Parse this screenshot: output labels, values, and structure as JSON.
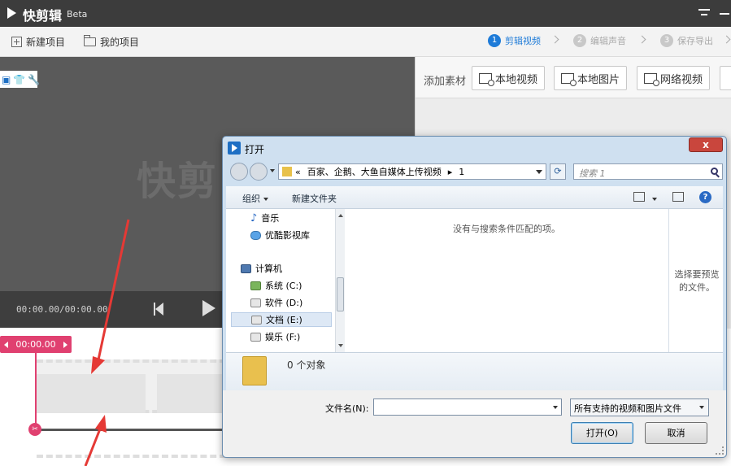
{
  "app": {
    "title": "快剪辑",
    "subtitle": "Beta"
  },
  "toolbar": {
    "new_project": "新建项目",
    "my_projects": "我的项目",
    "steps": [
      {
        "num": "1",
        "label": "剪辑视频",
        "active": true
      },
      {
        "num": "2",
        "label": "编辑声音",
        "active": false
      },
      {
        "num": "3",
        "label": "保存导出",
        "active": false
      }
    ]
  },
  "preview": {
    "watermark": "快剪",
    "timecode": "00:00.00/00:00.00"
  },
  "media": {
    "add_label": "添加素材",
    "local_video": "本地视频",
    "local_image": "本地图片",
    "web_video": "网络视频"
  },
  "timeline": {
    "time": "00:00.00"
  },
  "dialog": {
    "title": "打开",
    "close": "x",
    "breadcrumb": [
      "«",
      "百家、企鹅、大鱼自媒体上传视频",
      "▸",
      "1"
    ],
    "search_placeholder": "搜索 1",
    "organize": "组织",
    "new_folder": "新建文件夹",
    "nav_items": [
      {
        "label": "音乐",
        "icon": "music-icon"
      },
      {
        "label": "优酷影视库",
        "icon": "cloud-icon"
      },
      {
        "label": "计算机",
        "icon": "computer-icon"
      },
      {
        "label": "系统 (C:)",
        "icon": "system-drive-icon"
      },
      {
        "label": "软件 (D:)",
        "icon": "drive-icon"
      },
      {
        "label": "文档 (E:)",
        "icon": "drive-icon",
        "selected": true
      },
      {
        "label": "娱乐 (F:)",
        "icon": "drive-icon"
      }
    ],
    "empty_message": "没有与搜索条件匹配的项。",
    "preview_message": "选择要预览的文件。",
    "object_count": "0 个对象",
    "filename_label": "文件名(N):",
    "filename_value": "",
    "filter": "所有支持的视频和图片文件",
    "open_button": "打开(O)",
    "cancel_button": "取消"
  },
  "colors": {
    "accent": "#1e7bd8",
    "playhead": "#e04070",
    "annotation": "#e53935"
  }
}
